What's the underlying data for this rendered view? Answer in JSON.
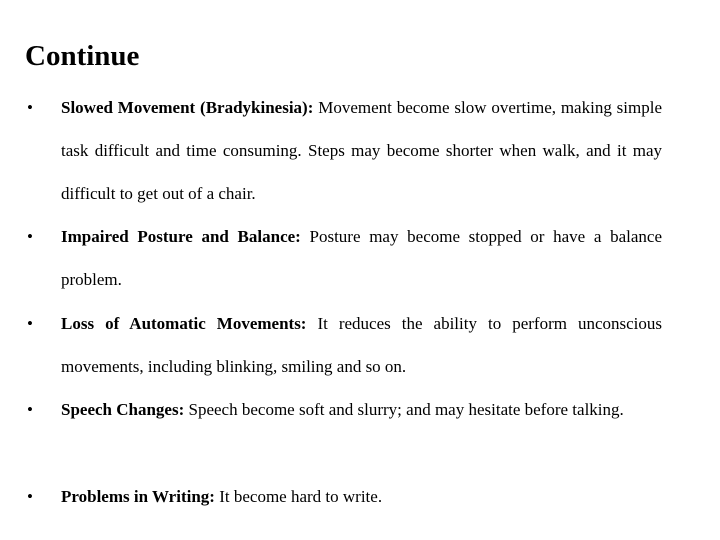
{
  "slide": {
    "title": "Continue",
    "bullet_glyph": "•",
    "items": [
      {
        "term": "Slowed Movement (Bradykinesia):",
        "text": " Movement become slow overtime, making simple task difficult and time consuming. Steps may become shorter when walk, and it may difficult to get out of a chair."
      },
      {
        "term": "Impaired Posture and Balance:",
        "text": " Posture may become stopped or have a balance problem."
      },
      {
        "term": "Loss of Automatic Movements:",
        "text": " It reduces the ability to perform unconscious movements, including blinking, smiling and so on."
      },
      {
        "term": "Speech Changes:",
        "text": " Speech become soft and slurry; and may hesitate before talking."
      },
      {
        "term": "Problems in Writing:",
        "text": " It become hard to write."
      }
    ]
  }
}
